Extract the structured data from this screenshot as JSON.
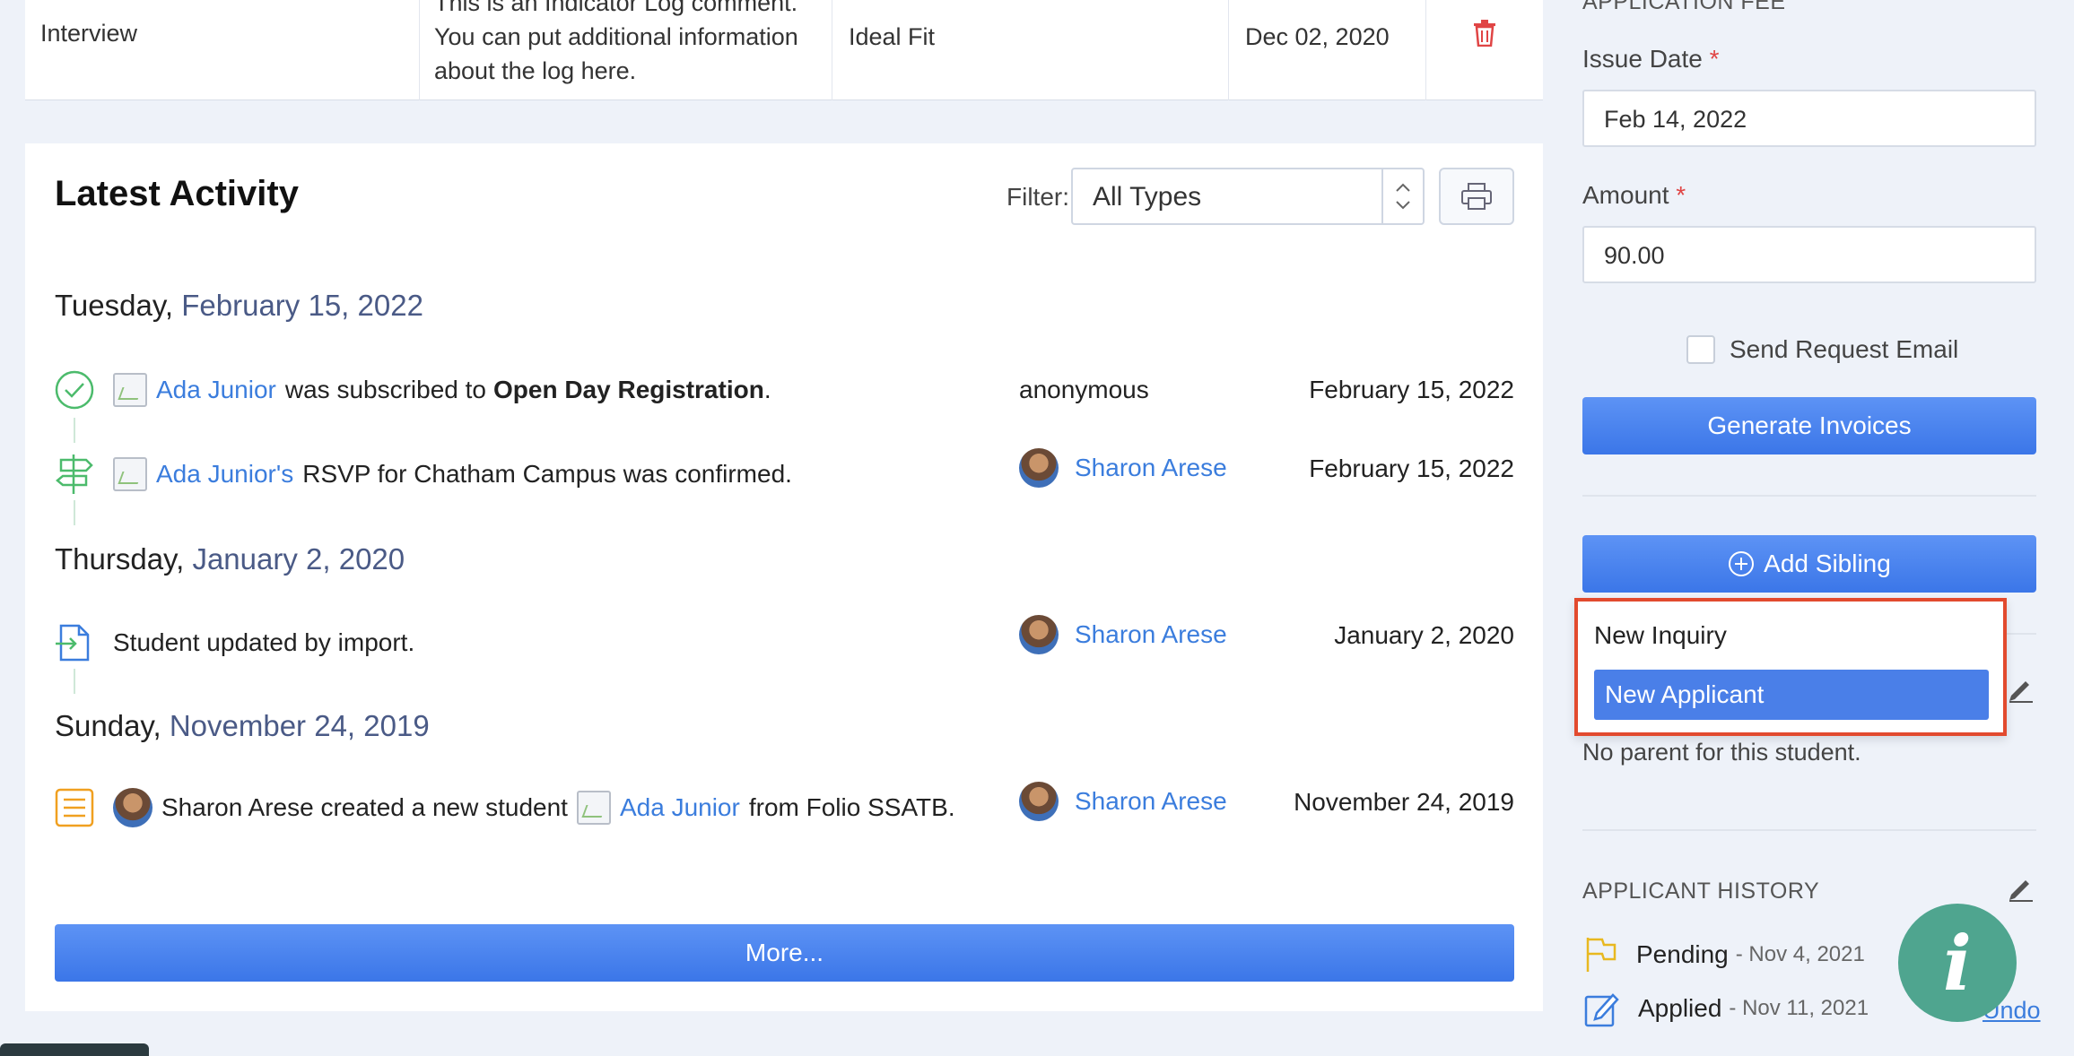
{
  "log_table": {
    "row": {
      "type": "Interview",
      "comment": "This is an Indicator Log comment. You can put additional information about the log here.",
      "result": "Ideal Fit",
      "date": "Dec 02, 2020"
    }
  },
  "activity": {
    "title": "Latest Activity",
    "filter_label": "Filter:",
    "filter_value": "All Types",
    "days": [
      {
        "weekday": "Tuesday,",
        "date": "February 15, 2022",
        "entries": [
          {
            "link": "Ada Junior",
            "text": "was subscribed to",
            "bold": "Open Day Registration",
            "end": ".",
            "user": "anonymous",
            "timestamp": "February 15, 2022"
          },
          {
            "link": "Ada Junior's",
            "text": "RSVP for Chatham Campus was confirmed.",
            "user": "Sharon Arese",
            "timestamp": "February 15, 2022"
          }
        ]
      },
      {
        "weekday": "Thursday,",
        "date": "January 2, 2020",
        "entries": [
          {
            "text": "Student updated by import.",
            "user": "Sharon Arese",
            "timestamp": "January 2, 2020"
          }
        ]
      },
      {
        "weekday": "Sunday,",
        "date": "November 24, 2019",
        "entries": [
          {
            "text": "Sharon Arese created a new student",
            "link": "Ada Junior",
            "end": "from Folio SSATB.",
            "user": "Sharon Arese",
            "timestamp": "November 24, 2019"
          }
        ]
      }
    ],
    "more_label": "More..."
  },
  "sidebar": {
    "section_cutoff": "APPLICATION FEE",
    "issue_date_label": "Issue Date",
    "issue_date_value": "Feb 14, 2022",
    "amount_label": "Amount",
    "amount_value": "90.00",
    "required_mark": "*",
    "send_email_label": "Send Request Email",
    "generate_label": "Generate Invoices",
    "add_sibling_label": "Add Sibling",
    "dropdown": {
      "items": [
        "New Inquiry",
        "New Applicant"
      ],
      "selected": "New Applicant"
    },
    "no_parent_text": "No parent for this student.",
    "history_title": "APPLICANT HISTORY",
    "history": [
      {
        "status": "Pending",
        "date": "- Nov 4, 2021"
      },
      {
        "status": "Applied",
        "date": "- Nov 11, 2021"
      }
    ],
    "undo_label": "Undo"
  },
  "colors": {
    "accent": "#3b7ddd",
    "button": "#4a7fe8",
    "highlight_border": "#e24a2e",
    "fab": "#4fa58f"
  }
}
